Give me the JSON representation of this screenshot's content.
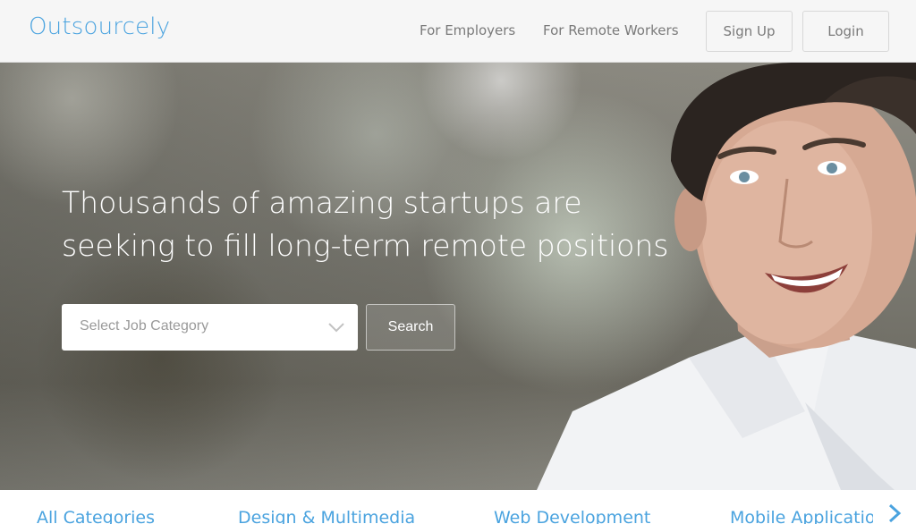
{
  "header": {
    "logo": "Outsourcely",
    "nav": {
      "employers": "For Employers",
      "workers": "For Remote Workers"
    },
    "buttons": {
      "signup": "Sign Up",
      "login": "Login"
    }
  },
  "hero": {
    "headline_line1": "Thousands of amazing startups are",
    "headline_line2": "seeking to fill long-term remote positions",
    "select_placeholder": "Select Job Category",
    "search_label": "Search"
  },
  "categories": {
    "items": [
      "All Categories",
      "Design & Multimedia",
      "Web Development",
      "Mobile Applicatio"
    ],
    "next_icon": "chevron-right-icon"
  },
  "colors": {
    "brand": "#4aa3df",
    "hero_text": "#ffffff"
  }
}
